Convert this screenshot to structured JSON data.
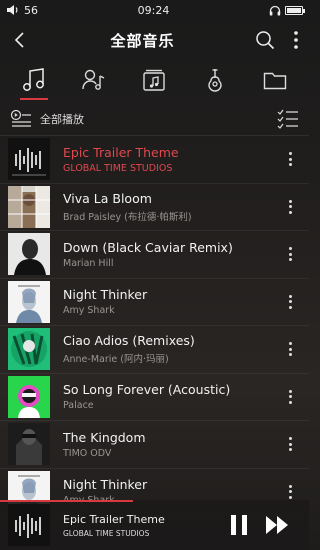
{
  "status": {
    "signal": "56",
    "time": "09:24"
  },
  "header": {
    "title": "全部音乐"
  },
  "tabs": [
    {
      "name": "songs",
      "active": true
    },
    {
      "name": "artists",
      "active": false
    },
    {
      "name": "albums",
      "active": false
    },
    {
      "name": "genres",
      "active": false
    },
    {
      "name": "folders",
      "active": false
    }
  ],
  "playall": {
    "label": "全部播放"
  },
  "songs": [
    {
      "title": "Epic Trailer Theme",
      "artist": "GLOBAL TIME STUDIOS",
      "current": true
    },
    {
      "title": "Viva La Bloom",
      "artist": "Brad Paisley (布拉德·帕斯利)"
    },
    {
      "title": "Down (Black Caviar Remix)",
      "artist": "Marian Hill"
    },
    {
      "title": "Night Thinker",
      "artist": "Amy Shark"
    },
    {
      "title": "Ciao Adios (Remixes)",
      "artist": "Anne-Marie (阿内·玛丽)"
    },
    {
      "title": "So Long Forever (Acoustic)",
      "artist": "Palace"
    },
    {
      "title": "The Kingdom",
      "artist": "TIMO ODV"
    },
    {
      "title": "Night Thinker",
      "artist": "Amy Shark"
    }
  ],
  "player": {
    "title": "Epic Trailer Theme",
    "artist": "GLOBAL TIME STUDIOS",
    "progress": 0.43
  },
  "colors": {
    "accent": "#d8393f"
  }
}
